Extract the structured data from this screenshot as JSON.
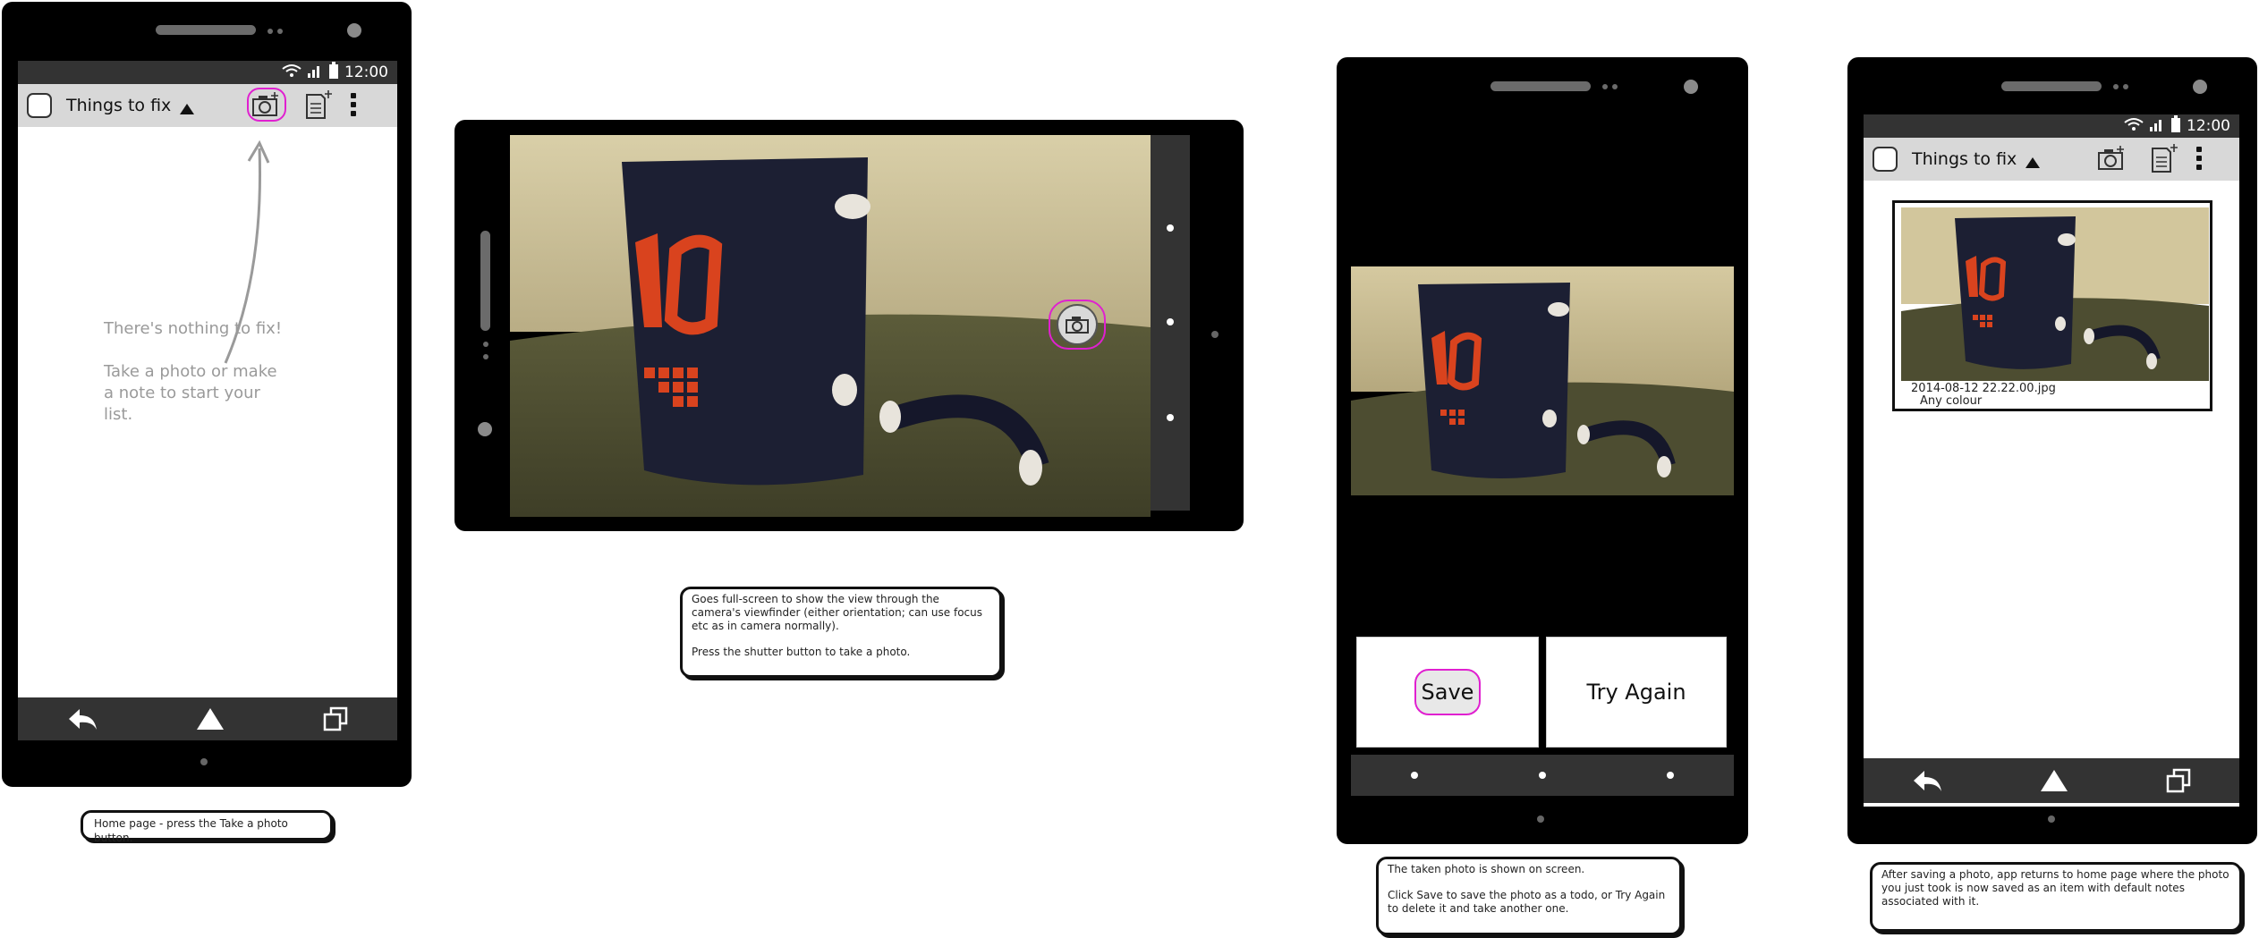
{
  "status": {
    "time": "12:00"
  },
  "home": {
    "title": "Things to fix",
    "empty_line1": "There's nothing to fix!",
    "empty_line2": "Take a photo or make a note to start your list."
  },
  "captions": {
    "home": "Home page - press the Take a photo button.",
    "camera_line1": "Goes full-screen to show the view through the camera's viewfinder (either orientation; can use focus etc as in camera normally).",
    "camera_line2": "Press the shutter button to take a photo.",
    "review_line1": "The taken photo is shown on screen.",
    "review_line2": "Click Save to save the photo as a todo, or Try Again to delete it and take another one.",
    "saved": "After saving a photo, app returns to home page where the photo you just took is now saved as an item with default notes associated with it."
  },
  "review": {
    "save_label": "Save",
    "try_again_label": "Try Again"
  },
  "list": {
    "title": "Things to fix",
    "items": [
      {
        "filename": "2014-08-12 22.22.00.jpg",
        "note": "Any colour"
      }
    ]
  },
  "colors": {
    "highlight": "#e020d0",
    "mug": "#1c1f33",
    "mug_text": "#d9431e"
  }
}
